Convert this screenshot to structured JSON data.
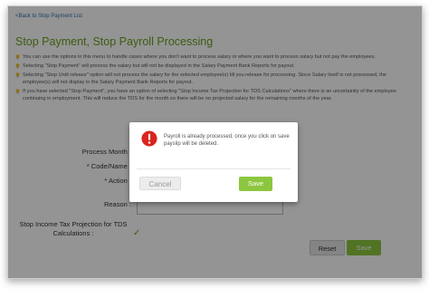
{
  "nav": {
    "back_link": "<Back to Stop Payment List"
  },
  "page": {
    "title": "Stop Payment, Stop Payroll Processing"
  },
  "notes": [
    "You can use the options in this menu to handle cases where you don't want to process salary or where you want to process salary but not pay the employees.",
    "Selecting \"Stop Payment\" will process the salary but will not be displayed in the Salary Payment Bank Reports for payout.",
    "Selecting \"Stop Until release\" option will not process the salary for the selected employee(s) till you release for processing. Since Salary itself is not processed, the employee(s) will not display in the Salary Payment Bank Reports for payout.",
    "If you have selected \"Stop Payment\", you have an option of selecting \"Stop Income Tax Projection for TDS Calculations\" where there is an uncertainity of the employee continuing in employment. This will reduce the TDS for the month so there will be no projected salary for the remaining months of the year."
  ],
  "form": {
    "process_month_label": "Process Month :",
    "code_name_label": "* Code/Name :",
    "action_label": "* Action :",
    "reason_label": "Reason :",
    "tds_label": "Stop Income Tax Projection for TDS Calculations :",
    "tds_checked": true,
    "reset_label": "Reset",
    "save_label": "Save"
  },
  "modal": {
    "message": "Payroll is already processed, once you click on save payslip will be deleted.",
    "cancel_label": "Cancel",
    "save_label": "Save",
    "icon": "error-icon"
  },
  "colors": {
    "accent_green": "#8cc63f",
    "title_green": "#6a9f1d",
    "error_red": "#d9251d",
    "link_blue": "#2d6fb4"
  }
}
